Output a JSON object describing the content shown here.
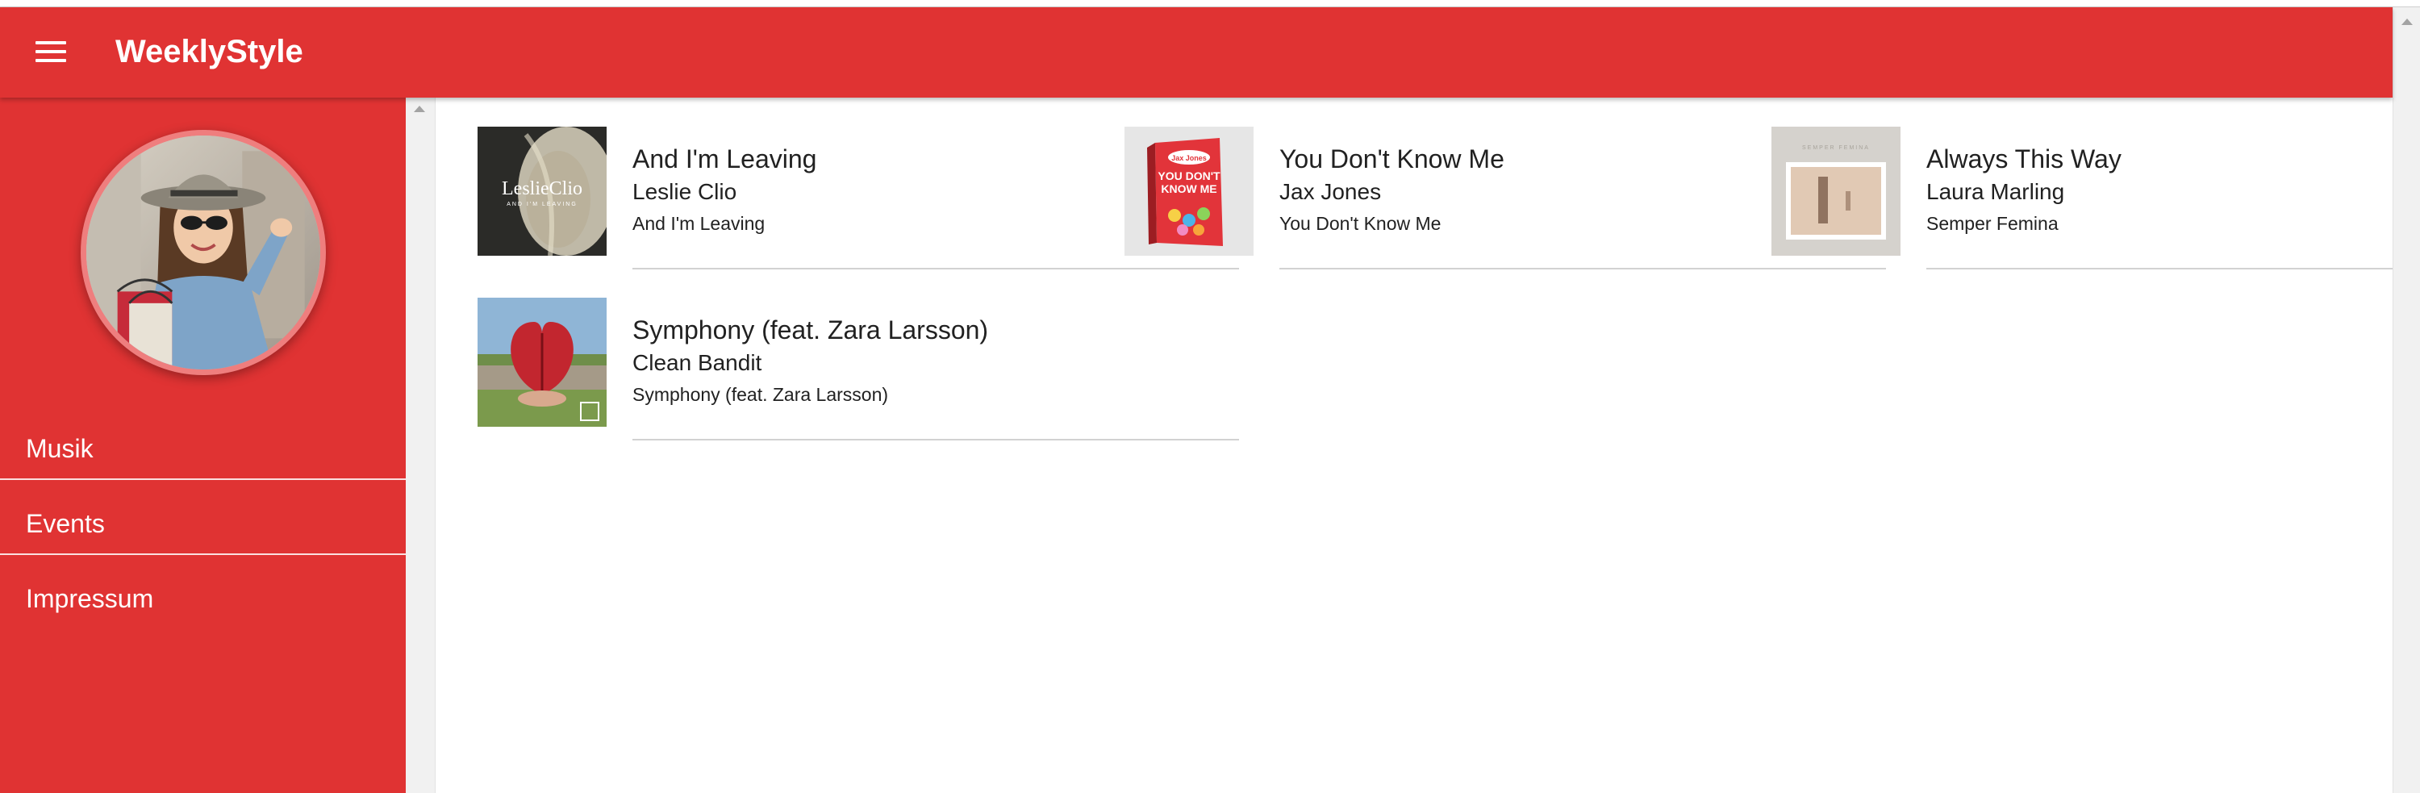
{
  "app": {
    "title": "WeeklyStyle"
  },
  "colors": {
    "primary": "#e03333",
    "avatar_ring": "#ef7e7e",
    "divider": "#d2d2d2",
    "text": "#212121"
  },
  "sidebar": {
    "items": [
      {
        "label": "Musik"
      },
      {
        "label": "Events"
      },
      {
        "label": "Impressum"
      }
    ]
  },
  "songs": [
    {
      "title": "And I'm Leaving",
      "artist": "Leslie Clio",
      "album": "And I'm Leaving",
      "cover": "leslie-clio-cover"
    },
    {
      "title": "You Don't Know Me",
      "artist": "Jax Jones",
      "album": "You Don't Know Me",
      "cover": "jax-jones-cover"
    },
    {
      "title": "Always This Way",
      "artist": "Laura Marling",
      "album": "Semper Femina",
      "cover": "laura-marling-cover"
    },
    {
      "title": "Symphony (feat. Zara Larsson)",
      "artist": "Clean Bandit",
      "album": "Symphony (feat. Zara Larsson)",
      "cover": "clean-bandit-cover"
    }
  ],
  "icons": {
    "menu": "menu-icon",
    "scroll_up": "chevron-up-icon"
  }
}
